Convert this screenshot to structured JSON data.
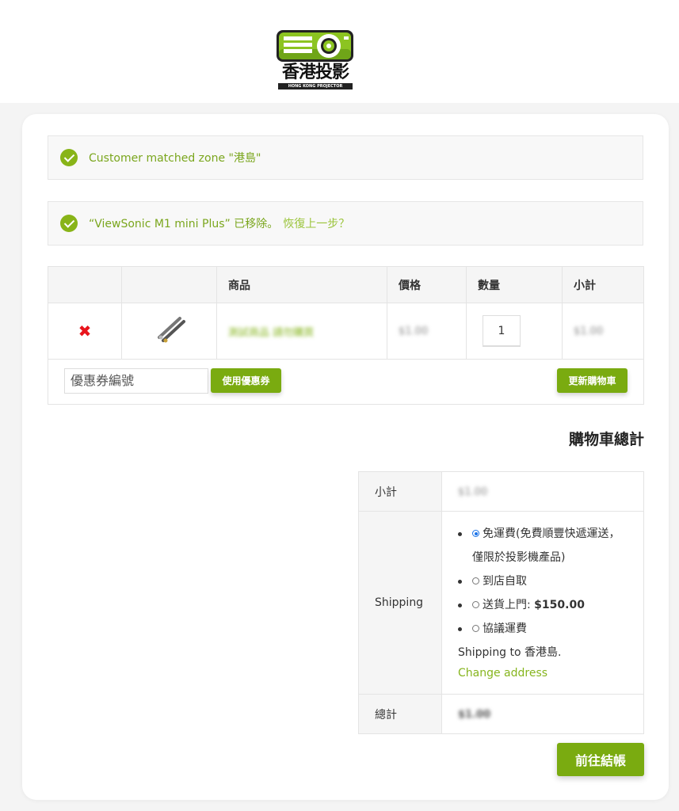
{
  "brand": {
    "name": "香港投影",
    "subtitle": "HONG KONG PROJECTOR",
    "accent": "#7aab10"
  },
  "notices": [
    {
      "text": "Customer matched zone \"港島\"",
      "link": ""
    },
    {
      "text": "“ViewSonic M1 mini Plus” 已移除。",
      "link": "恢復上一步？"
    }
  ],
  "cart": {
    "headers": [
      "",
      "",
      "商品",
      "價格",
      "數量",
      "小計"
    ],
    "items": [
      {
        "remove": "✖",
        "name": "測試商品 請勿購買",
        "price": "$1.00",
        "quantity": "1",
        "subtotal": "$1.00"
      }
    ],
    "coupon_placeholder": "優惠券編號",
    "apply_coupon_label": "使用優惠券",
    "update_cart_label": "更新購物車"
  },
  "totals": {
    "title": "購物車總計",
    "subtotal_label": "小計",
    "subtotal_value": "$1.00",
    "shipping_label": "Shipping",
    "shipping_options": [
      {
        "label": "免運費(免費順豐快遞運送，",
        "label2": "僅限於投影機產品)",
        "selected": true
      },
      {
        "label": "到店自取",
        "selected": false
      },
      {
        "label": "送貨上門: ",
        "price": "$150.00",
        "selected": false
      },
      {
        "label": "協議運費",
        "selected": false
      }
    ],
    "shipping_to_prefix": "Shipping to ",
    "shipping_to_region": "香港島",
    "shipping_to_suffix": ".",
    "change_address_label": "Change address",
    "total_label": "總計",
    "total_value": "$1.00"
  },
  "checkout_label": "前往結帳"
}
